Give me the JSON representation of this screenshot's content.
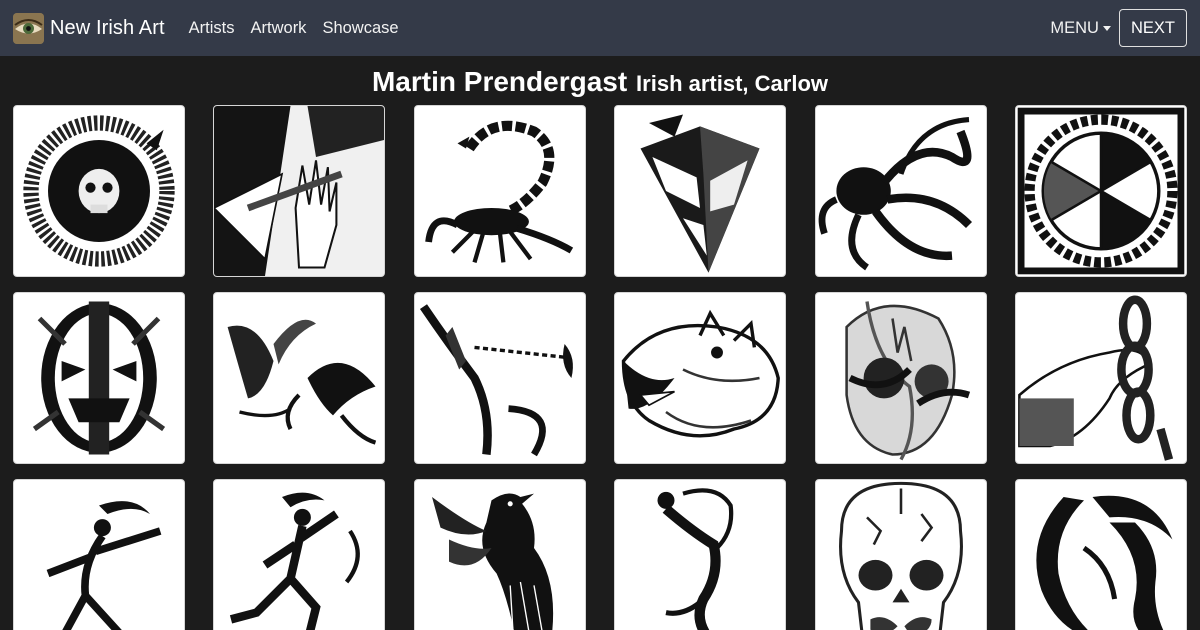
{
  "navbar": {
    "brand": {
      "name": "New Irish Art",
      "logo_icon": "eye-logo-icon"
    },
    "links": [
      {
        "label": "Artists"
      },
      {
        "label": "Artwork"
      },
      {
        "label": "Showcase"
      }
    ],
    "menu_label": "MENU",
    "next_label": "NEXT"
  },
  "page": {
    "artist_name": "Martin Prendergast",
    "artist_subtitle": "Irish artist, Carlow"
  },
  "gallery": {
    "artworks": [
      {
        "icon": "ouroboros-skull-artwork-icon"
      },
      {
        "icon": "hand-geometric-artwork-icon"
      },
      {
        "icon": "scorpion-artwork-icon"
      },
      {
        "icon": "crystal-pendulum-artwork-icon"
      },
      {
        "icon": "octopus-artwork-icon"
      },
      {
        "icon": "celtic-wheel-artwork-icon"
      },
      {
        "icon": "tribal-mask-artwork-icon"
      },
      {
        "icon": "birds-flying-artwork-icon"
      },
      {
        "icon": "chain-blade-artwork-icon"
      },
      {
        "icon": "wolf-head-artwork-icon"
      },
      {
        "icon": "skull-hands-artwork-icon"
      },
      {
        "icon": "hand-chain-artwork-icon"
      },
      {
        "icon": "tribal-figure-leaping-artwork-icon"
      },
      {
        "icon": "tribal-figure-running-artwork-icon"
      },
      {
        "icon": "raven-artwork-icon"
      },
      {
        "icon": "tribal-figure-reaching-artwork-icon"
      },
      {
        "icon": "cracked-skull-artwork-icon"
      },
      {
        "icon": "tribal-moon-figure-artwork-icon"
      }
    ]
  },
  "colors": {
    "navbar_bg": "#343a48",
    "page_bg": "#1c1c1c",
    "card_bg": "#ffffff"
  }
}
